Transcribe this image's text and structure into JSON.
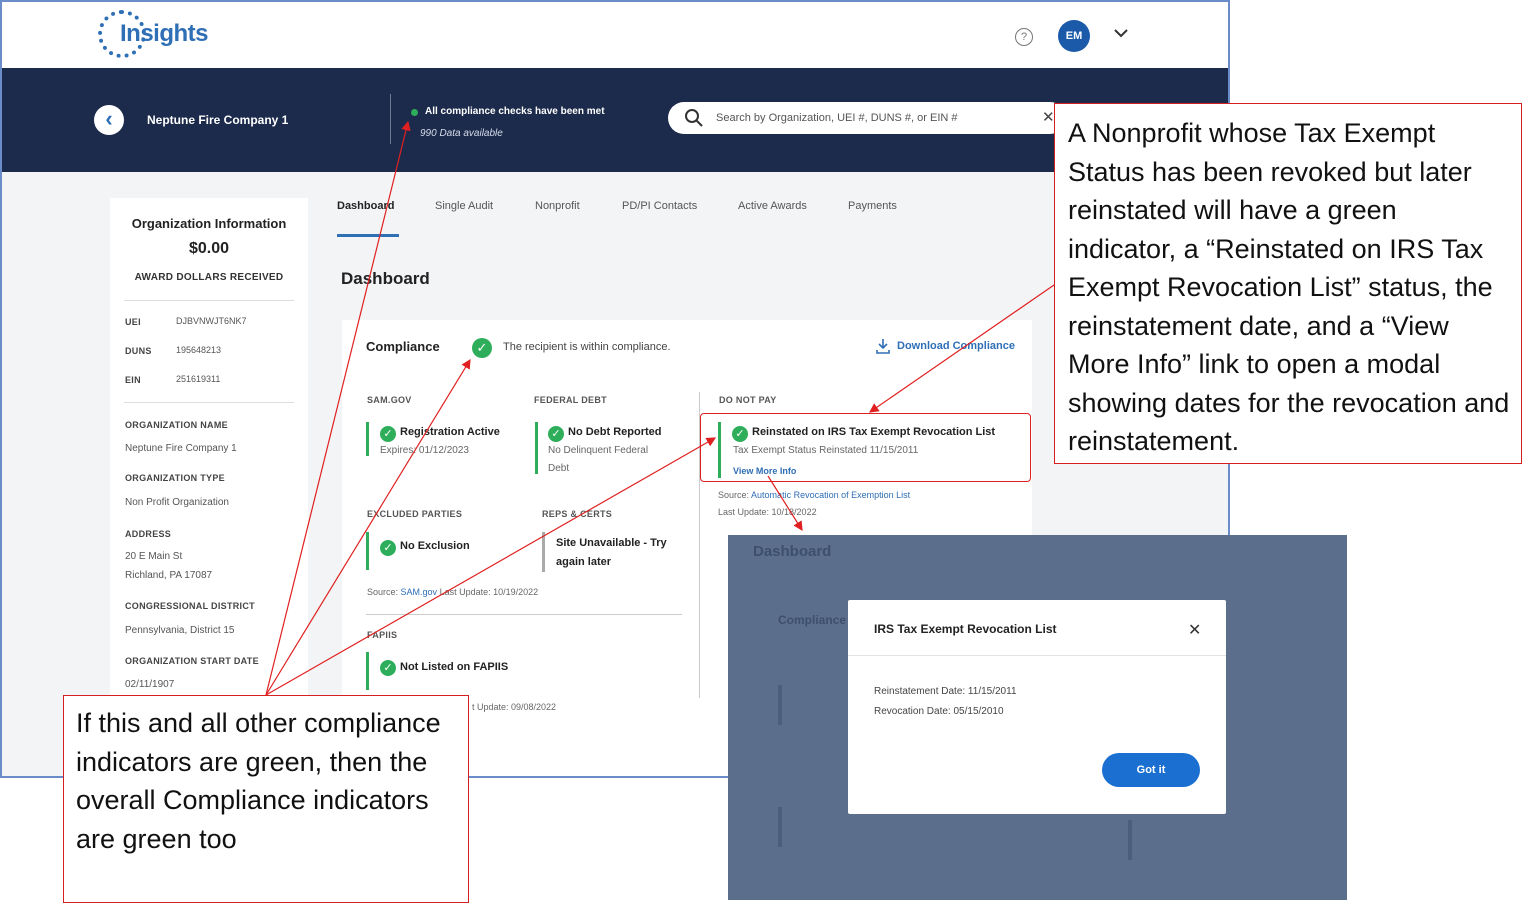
{
  "header": {
    "logo_small_text": "Insights",
    "logo_word": "Insights",
    "logo_tagline": "",
    "avatar_initials": "EM",
    "help_icon": "question-circle-icon",
    "menu_icon": "chevron-down-icon"
  },
  "banner": {
    "org_name": "Neptune Fire Company 1",
    "compliance_status": "All compliance checks have been met",
    "data_available": "990 Data available",
    "search_placeholder": "Search by Organization, UEI #, DUNS #, or EIN #",
    "status_color": "#2eae5b"
  },
  "tabs": [
    "Dashboard",
    "Single Audit",
    "Nonprofit",
    "PD/PI Contacts",
    "Active Awards",
    "Payments"
  ],
  "org_info": {
    "title": "Organization Information",
    "amount": "$0.00",
    "amount_label": "AWARD DOLLARS RECEIVED",
    "uei_label": "UEI",
    "uei": "DJBVNWJT6NK7",
    "duns_label": "DUNS",
    "duns": "195648213",
    "ein_label": "EIN",
    "ein": "251619311",
    "org_name_label": "ORGANIZATION NAME",
    "org_name": "Neptune Fire Company 1",
    "org_type_label": "ORGANIZATION TYPE",
    "org_type": "Non Profit Organization",
    "address_label": "ADDRESS",
    "address_line1": "20 E Main St",
    "address_line2": "Richland, PA 17087",
    "district_label": "CONGRESSIONAL DISTRICT",
    "district": "Pennsylvania, District 15",
    "start_label": "ORGANIZATION START DATE",
    "start_date": "02/11/1907"
  },
  "dashboard": {
    "heading": "Dashboard",
    "compliance_title": "Compliance",
    "compliance_msg": "The recipient is within compliance.",
    "download": "Download Compliance",
    "sam": {
      "header": "SAM.GOV",
      "status": "Registration Active",
      "detail": "Expires: 01/12/2023"
    },
    "debt": {
      "header": "FEDERAL DEBT",
      "status": "No Debt Reported",
      "detail1": "No Delinquent Federal",
      "detail2": "Debt"
    },
    "dnp": {
      "header": "DO NOT PAY",
      "status": "Reinstated on IRS Tax Exempt Revocation List",
      "detail": "Tax Exempt Status Reinstated 11/15/2011",
      "link": "View More Info",
      "source_prefix": "Source:",
      "source_link": "Automatic Revocation of Exemption List",
      "last_update": "Last Update: 10/18/2022"
    },
    "excluded": {
      "header": "EXCLUDED PARTIES",
      "status": "No Exclusion"
    },
    "reps": {
      "header": "REPS & CERTS",
      "status1": "Site Unavailable - Try",
      "status2": "again later"
    },
    "sam_source_prefix": "Source:",
    "sam_source_link": "SAM.gov",
    "sam_last_update": "Last Update: 10/19/2022",
    "fapiis": {
      "header": "FAPIIS",
      "status": "Not Listed on FAPIIS",
      "last_update": "t Update: 09/08/2022"
    }
  },
  "modal_shot": {
    "bg_heading": "Dashboard",
    "bg_compliance": "Compliance",
    "modal_title": "IRS Tax Exempt Revocation List",
    "reinstatement": "Reinstatement Date: 11/15/2011",
    "revocation": "Revocation Date: 05/15/2010",
    "button": "Got it"
  },
  "annotations": {
    "right": "A Nonprofit whose Tax Exempt Status has been revoked but later reinstated will have a green indicator, a “Reinstated on IRS Tax Exempt Revocation List” status, the reinstatement date, and a “View More Info” link to open a modal showing dates for the revocation and reinstatement.",
    "left": "If this and all other compliance indicators are green, then the overall Compliance indicators are green too",
    "color": "#e02020"
  }
}
